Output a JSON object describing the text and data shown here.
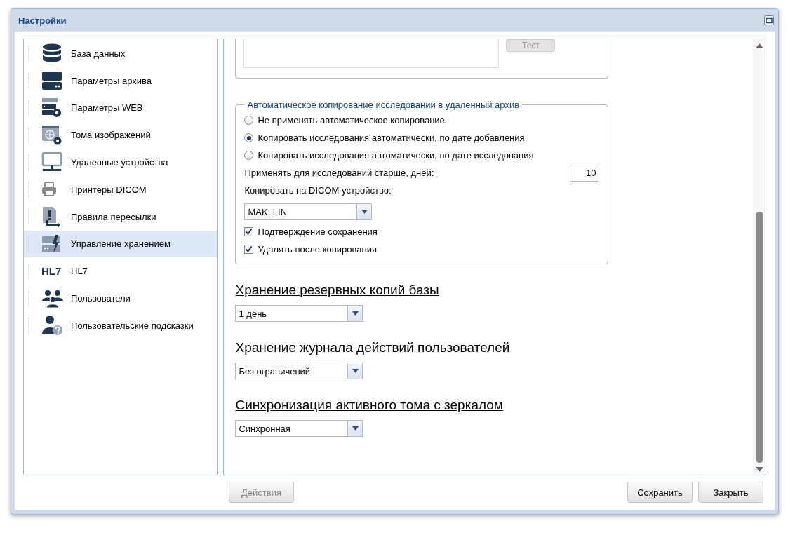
{
  "window": {
    "title": "Настройки"
  },
  "sidebar": {
    "items": [
      {
        "label": "База данных",
        "kind": "database",
        "selected": false
      },
      {
        "label": "Параметры архива",
        "kind": "server",
        "selected": false
      },
      {
        "label": "Параметры WEB",
        "kind": "servergear",
        "selected": false
      },
      {
        "label": "Тома изображений",
        "kind": "globegear",
        "selected": false
      },
      {
        "label": "Удаленные устройства",
        "kind": "monitor",
        "selected": false
      },
      {
        "label": "Принтеры DICOM",
        "kind": "printer",
        "selected": false
      },
      {
        "label": "Правила пересылки",
        "kind": "forward",
        "selected": false
      },
      {
        "label": "Управление хранением",
        "kind": "storage",
        "selected": true
      },
      {
        "label": "HL7",
        "kind": "hl7",
        "badge": "HL7",
        "selected": false
      },
      {
        "label": "Пользователи",
        "kind": "users",
        "selected": false
      },
      {
        "label": "Пользовательские подсказки",
        "kind": "userhelp",
        "selected": false
      }
    ]
  },
  "top_group": {
    "test_button": "Тест"
  },
  "auto_copy": {
    "legend": "Автоматическое копирование исследований в удаленный архив",
    "options": [
      {
        "label": "Не применять автоматическое копирование",
        "selected": false
      },
      {
        "label": "Копировать исследования автоматически, по дате добавления",
        "selected": true
      },
      {
        "label": "Копировать исследования автоматически, по дате исследования",
        "selected": false
      }
    ],
    "older_label": "Применять для исследований старше, дней:",
    "older_value": "10",
    "device_label": "Копировать на DICOM устройство:",
    "device_value": "MAK_LIN",
    "checks": [
      {
        "label": "Подтверждение сохранения",
        "checked": true
      },
      {
        "label": "Удалять после копирования",
        "checked": true
      }
    ]
  },
  "sections": [
    {
      "heading": "Хранение резервных копий базы",
      "value": "1 день"
    },
    {
      "heading": "Хранение журнала действий пользователей",
      "value": "Без ограничений"
    },
    {
      "heading": "Синхронизация активного тома с зеркалом",
      "value": "Синхронная"
    }
  ],
  "buttons": {
    "actions": {
      "label": "Действия",
      "disabled": true
    },
    "save": "Сохранить",
    "close": "Закрыть"
  }
}
